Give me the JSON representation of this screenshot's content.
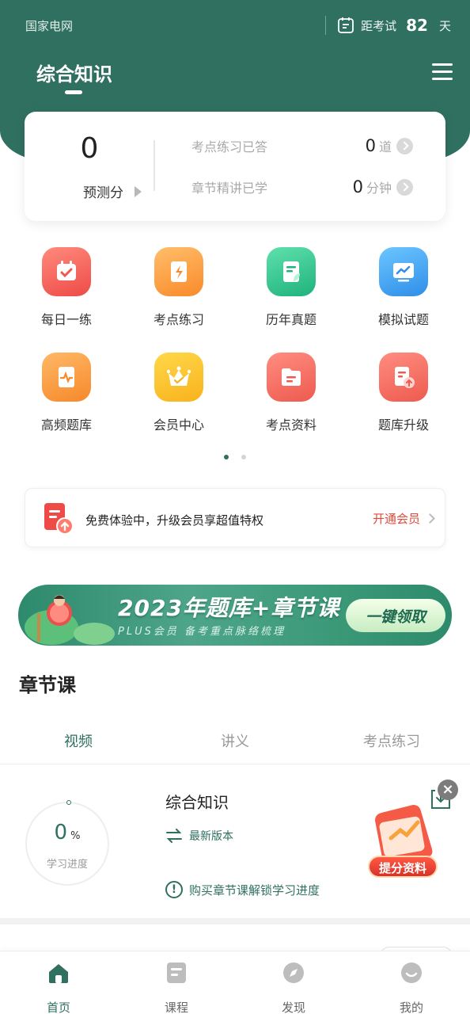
{
  "header": {
    "brand": "国家电网",
    "exam_label": "距考试",
    "exam_days": "82",
    "exam_unit": "天",
    "subject": "综合知识"
  },
  "stats": {
    "score": "0",
    "score_label": "预测分",
    "rows": [
      {
        "label": "考点练习已答",
        "value": "0",
        "unit": "道"
      },
      {
        "label": "章节精讲已学",
        "value": "0",
        "unit": "分钟"
      }
    ]
  },
  "grid": [
    {
      "label": "每日一练",
      "icon": "calendar-check-icon"
    },
    {
      "label": "考点练习",
      "icon": "lightning-book-icon"
    },
    {
      "label": "历年真题",
      "icon": "document-leaf-icon"
    },
    {
      "label": "模拟试题",
      "icon": "chart-monitor-icon"
    },
    {
      "label": "高频题库",
      "icon": "scroll-wave-icon"
    },
    {
      "label": "会员中心",
      "icon": "crown-icon"
    },
    {
      "label": "考点资料",
      "icon": "folder-icon"
    },
    {
      "label": "题库升级",
      "icon": "document-upload-icon"
    }
  ],
  "pager": {
    "active_index": 0,
    "total": 2
  },
  "promo": {
    "text": "免费体验中，升级会员享超值特权",
    "cta": "开通会员"
  },
  "banner": {
    "title": "2023年题库+章节课",
    "subtitle": "PLUS会员 备考重点脉络梳理",
    "button": "一键领取"
  },
  "chapter": {
    "title": "章节课",
    "tabs": [
      {
        "label": "视频",
        "active": true
      },
      {
        "label": "讲义",
        "active": false
      },
      {
        "label": "考点练习",
        "active": false
      }
    ],
    "progress_value": "0",
    "progress_unit": "%",
    "progress_label": "学习进度",
    "course_title": "综合知识",
    "version_label": "最新版本",
    "unlock_text": "购买章节课解锁学习进度",
    "float_label": "提分资料"
  },
  "tabbar": [
    {
      "label": "首页",
      "icon": "home-icon",
      "active": true
    },
    {
      "label": "课程",
      "icon": "course-icon",
      "active": false
    },
    {
      "label": "发现",
      "icon": "compass-icon",
      "active": false
    },
    {
      "label": "我的",
      "icon": "profile-icon",
      "active": false
    }
  ],
  "colors": {
    "primary": "#2f7060",
    "accent_red": "#e04a3a",
    "muted": "#a9a9a9"
  }
}
